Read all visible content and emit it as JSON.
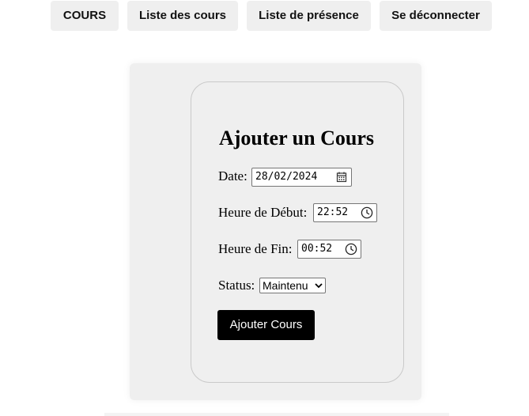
{
  "nav": {
    "items": [
      {
        "label": "COURS"
      },
      {
        "label": "Liste des cours"
      },
      {
        "label": "Liste de présence"
      },
      {
        "label": "Se déconnecter"
      }
    ]
  },
  "form": {
    "title": "Ajouter un Cours",
    "date": {
      "label": "Date:",
      "value": "28/02/2024",
      "icon": "calendar-icon"
    },
    "start_time": {
      "label": "Heure de Début:",
      "value": "22:52",
      "icon": "clock-icon"
    },
    "end_time": {
      "label": "Heure de Fin:",
      "value": "00:52",
      "icon": "clock-icon"
    },
    "status": {
      "label": "Status:",
      "selected": "Maintenu"
    },
    "submit_label": "Ajouter Cours"
  },
  "colors": {
    "nav_bg": "#efefef",
    "panel_bg": "#efefef",
    "submit_bg": "#000000",
    "submit_text": "#ffffff"
  }
}
